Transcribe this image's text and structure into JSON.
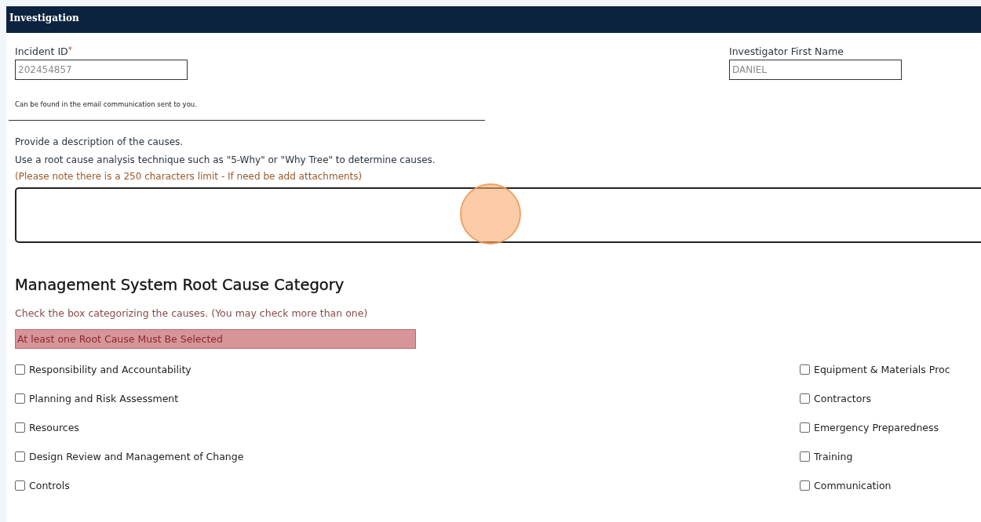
{
  "section": {
    "title": "Investigation"
  },
  "incident_id": {
    "label": "Incident ID",
    "required_mark": "*",
    "value": "202454857",
    "help": "Can be found in the email communication sent to you."
  },
  "investigator_first_name": {
    "label": "Investigator First Name",
    "value": "DANIEL"
  },
  "description": {
    "lines": [
      "Provide a description of the causes.",
      "Use a root cause analysis technique such as \"5-Why\" or \"Why Tree\" to determine causes."
    ],
    "note": "(Please note there is a 250 characters limit - If need be add attachments)"
  },
  "root_cause": {
    "heading": "Management System Root Cause Category",
    "instructions": "Check the box categorizing the causes. (You may check more than one)",
    "error": "At least one Root Cause Must Be Selected",
    "left": [
      {
        "label": "Responsibility and Accountability",
        "checked": false
      },
      {
        "label": "Planning and Risk Assessment",
        "checked": false
      },
      {
        "label": "Resources",
        "checked": false
      },
      {
        "label": "Design Review and Management of Change",
        "checked": false
      },
      {
        "label": "Controls",
        "checked": false
      }
    ],
    "right": [
      {
        "label": "Equipment & Materials Proc",
        "checked": false
      },
      {
        "label": "Contractors",
        "checked": false
      },
      {
        "label": "Emergency Preparedness",
        "checked": false
      },
      {
        "label": "Training",
        "checked": false
      },
      {
        "label": "Communication",
        "checked": false
      }
    ]
  }
}
